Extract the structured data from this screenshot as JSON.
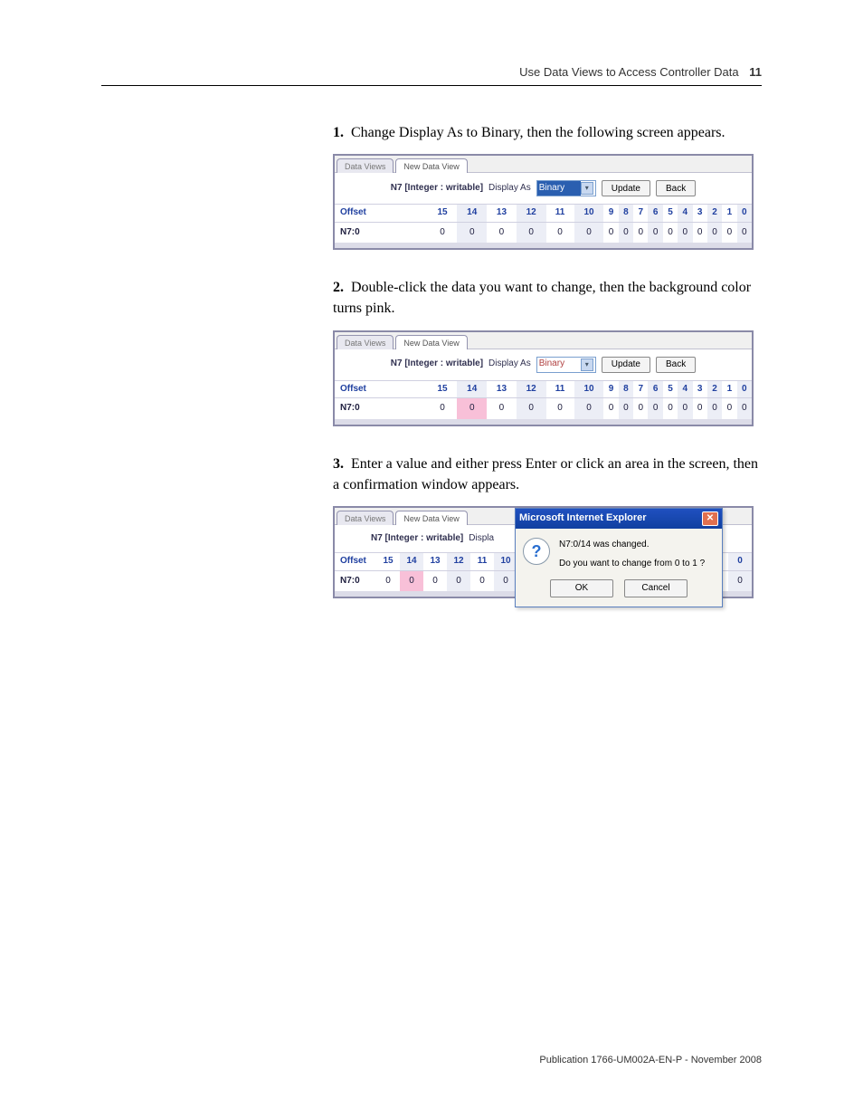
{
  "header": {
    "title": "Use Data Views to Access Controller Data",
    "chapter": "11"
  },
  "steps": {
    "s1": {
      "num": "1.",
      "text": "Change Display As to Binary, then the following screen appears."
    },
    "s2": {
      "num": "2.",
      "text": "Double-click the data you want to change, then the background color turns pink."
    },
    "s3": {
      "num": "3.",
      "text": "Enter a value and either press Enter or click an area in the screen, then a confirmation window appears."
    }
  },
  "shot": {
    "tab1": "Data Views",
    "tab2": "New Data View",
    "datalabel": "N7 [Integer : writable]",
    "displayas": "Display As",
    "selectval": "Binary",
    "update": "Update",
    "back": "Back",
    "offset": "Offset",
    "rowlabel": "N7:0",
    "cols": [
      "15",
      "14",
      "13",
      "12",
      "11",
      "10",
      "9",
      "8",
      "7",
      "6",
      "5",
      "4",
      "3",
      "2",
      "1",
      "0"
    ],
    "vals": [
      "0",
      "0",
      "0",
      "0",
      "0",
      "0",
      "0",
      "0",
      "0",
      "0",
      "0",
      "0",
      "0",
      "0",
      "0",
      "0"
    ]
  },
  "shot3": {
    "displayas_trunc": "Displa",
    "cols": [
      "15",
      "14",
      "13",
      "12",
      "11",
      "10"
    ],
    "vals": [
      "0",
      "0",
      "0",
      "0",
      "0",
      "0"
    ],
    "rightcol0": "0",
    "rightval0": "0"
  },
  "dialog": {
    "title": "Microsoft Internet Explorer",
    "line1": "N7:0/14 was changed.",
    "line2": "Do you want to change from 0 to 1 ?",
    "ok": "OK",
    "cancel": "Cancel"
  },
  "footer": "Publication 1766-UM002A-EN-P - November 2008"
}
